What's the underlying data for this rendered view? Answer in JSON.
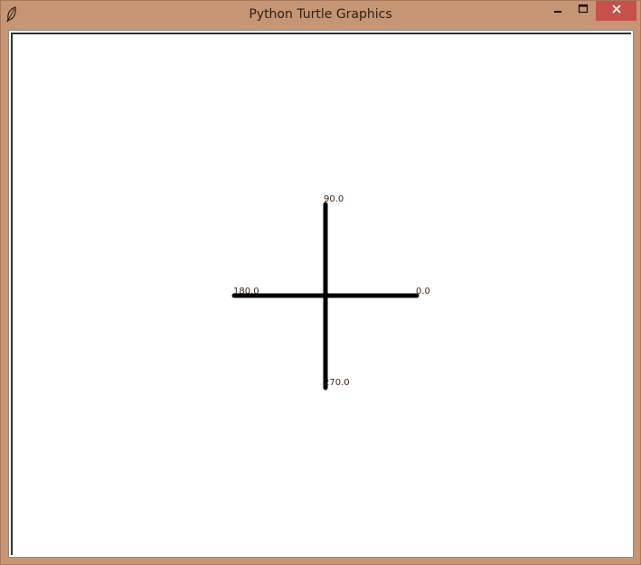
{
  "window": {
    "title": "Python Turtle Graphics",
    "icon": "feather-icon"
  },
  "controls": {
    "minimize_icon": "minimize-icon",
    "maximize_icon": "maximize-icon",
    "close_icon": "close-icon",
    "close_color": "#c7504a"
  },
  "canvas": {
    "background": "#ffffff",
    "stroke_color": "#000000",
    "labels": {
      "east": "0.0",
      "north": "90.0",
      "west": "180.0",
      "south": "270.0"
    }
  }
}
